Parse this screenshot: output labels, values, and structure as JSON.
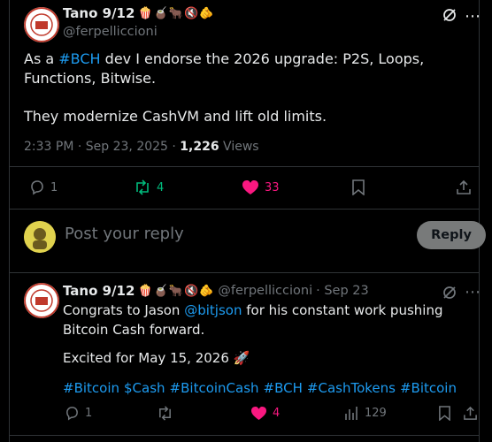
{
  "main_post": {
    "display_name": "Tano 9/12",
    "name_emojis": "🍿🧉🐂🔇🫵",
    "handle": "@ferpelliccioni",
    "text_before_tag": "As a ",
    "tag": "#BCH",
    "text_after_tag": " dev I endorse the 2026 upgrade: P2S, Loops, Functions, Bitwise.",
    "text_line2": "They modernize CashVM and lift old limits.",
    "time": "2:33 PM · Sep 23, 2025 · ",
    "views_count": "1,226",
    "views_label": " Views",
    "replies": "1",
    "reposts": "4",
    "likes": "33"
  },
  "reply_box": {
    "placeholder": "Post your reply",
    "button": "Reply"
  },
  "reply_post": {
    "display_name": "Tano 9/12",
    "name_emojis": "🍿🧉🐂🔇🫵",
    "handle": "@ferpelliccioni",
    "date": "· Sep 23",
    "text_a": "Congrats to Jason ",
    "mention": "@bitjson",
    "text_b": " for his constant work pushing Bitcoin Cash forward.",
    "text_line2": "Excited for May 15, 2026",
    "rocket": "🚀",
    "hashtags": [
      "#Bitcoin",
      "$Cash",
      "#BitcoinCash",
      "#BCH",
      "#CashTokens",
      "#Bitcoin"
    ],
    "replies": "1",
    "reposts": "",
    "likes": "4",
    "views": "129"
  },
  "colors": {
    "background": "#000000",
    "text": "#e7e9ea",
    "muted": "#71767b",
    "link": "#1d9bf0",
    "like": "#f91880",
    "repost": "#00ba7c"
  }
}
